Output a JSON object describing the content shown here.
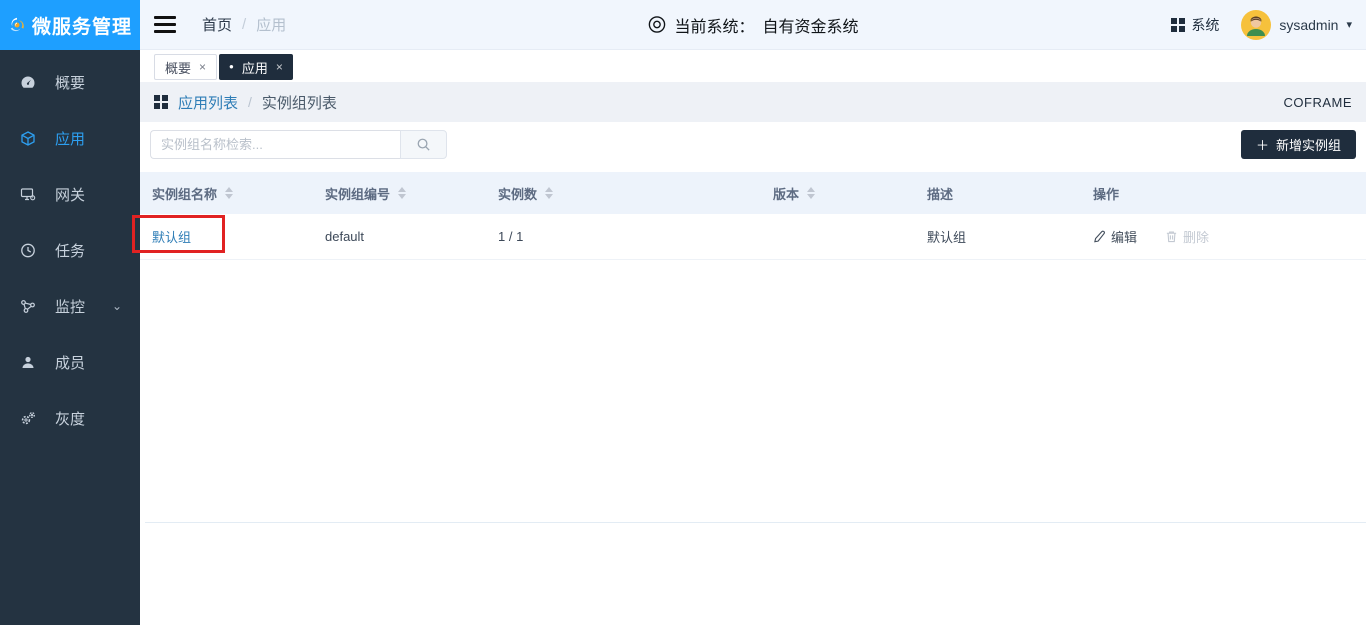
{
  "app": {
    "title": "微服务管理"
  },
  "topbar": {
    "breadcrumb": {
      "home": "首页",
      "current": "应用"
    },
    "current_system": {
      "label": "当前系统：",
      "value": "自有资金系统"
    },
    "system_menu": "系统",
    "username": "sysadmin"
  },
  "sidebar": {
    "items": [
      {
        "label": "概要",
        "icon": "dashboard-icon",
        "active": false
      },
      {
        "label": "应用",
        "icon": "cube-icon",
        "active": true
      },
      {
        "label": "网关",
        "icon": "gateway-icon",
        "active": false
      },
      {
        "label": "任务",
        "icon": "clock-icon",
        "active": false
      },
      {
        "label": "监控",
        "icon": "nodes-icon",
        "active": false,
        "expandable": true
      },
      {
        "label": "成员",
        "icon": "user-icon",
        "active": false
      },
      {
        "label": "灰度",
        "icon": "gears-icon",
        "active": false
      }
    ]
  },
  "tabs": [
    {
      "label": "概要",
      "active": false
    },
    {
      "label": "应用",
      "active": true
    }
  ],
  "page_header": {
    "breadcrumb_link": "应用列表",
    "breadcrumb_current": "实例组列表",
    "brand": "COFRAME"
  },
  "toolbar": {
    "search_placeholder": "实例组名称检索...",
    "add_button_plus": "＋",
    "add_button": "新增实例组"
  },
  "table": {
    "columns": [
      "实例组名称",
      "实例组编号",
      "实例数",
      "版本",
      "描述",
      "操作"
    ],
    "rows": [
      {
        "name": "默认组",
        "code": "default",
        "instances": "1 / 1",
        "version": "",
        "description": "默认组",
        "edit": "编辑",
        "delete": "删除"
      }
    ]
  },
  "glyphs": {
    "close": "×",
    "caret_down": "▾",
    "slash": "/",
    "bullet": "●",
    "chevron_down": "⌄"
  },
  "colors": {
    "accent_blue": "#1e9fff",
    "sidebar_bg": "#243341",
    "dark_navy": "#1f2d3d",
    "link_blue": "#2e7db6",
    "table_header_bg": "#edf3fb",
    "annotation_red": "#e12222"
  }
}
